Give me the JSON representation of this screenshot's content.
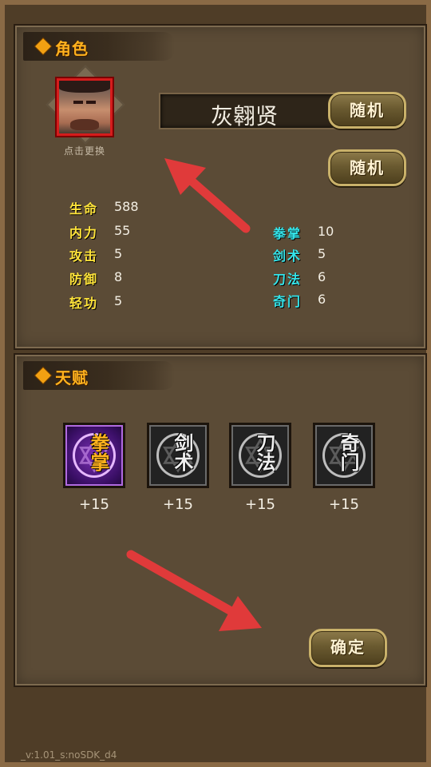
{
  "role_section": {
    "title": "角色",
    "portrait_caption": "点击更换",
    "name": "灰翱贤",
    "random_button_1": "随机",
    "random_button_2": "随机",
    "stats_left": [
      {
        "label": "生命",
        "value": "588"
      },
      {
        "label": "内力",
        "value": "55"
      },
      {
        "label": "攻击",
        "value": "5"
      },
      {
        "label": "防御",
        "value": "8"
      },
      {
        "label": "轻功",
        "value": "5"
      }
    ],
    "stats_right": [
      {
        "label": "拳掌",
        "value": "10"
      },
      {
        "label": "剑术",
        "value": "5"
      },
      {
        "label": "刀法",
        "value": "6"
      },
      {
        "label": "奇门",
        "value": "6"
      }
    ]
  },
  "talent_section": {
    "title": "天赋",
    "talents": [
      {
        "glyph": "拳掌",
        "bonus": "+15",
        "selected": true
      },
      {
        "glyph": "剑术",
        "bonus": "+15",
        "selected": false
      },
      {
        "glyph": "刀法",
        "bonus": "+15",
        "selected": false
      },
      {
        "glyph": "奇门",
        "bonus": "+15",
        "selected": false
      }
    ]
  },
  "confirm_button": "确定",
  "version": "_v:1.01_s:noSDK_d4",
  "colors": {
    "accent_orange": "#ffb21e",
    "stat_yellow": "#ffe43a",
    "stat_cyan": "#34e4ea",
    "arrow_red": "#e03a3a"
  }
}
